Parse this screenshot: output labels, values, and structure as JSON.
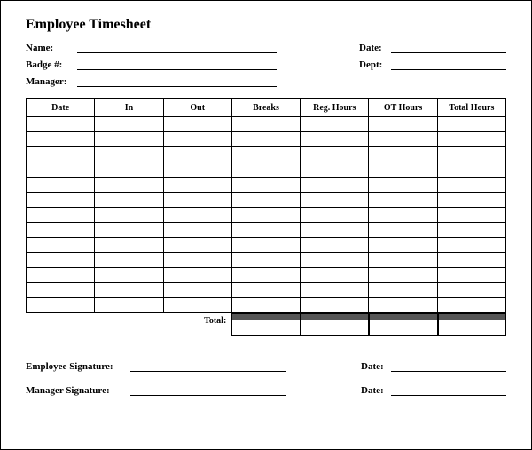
{
  "title": "Employee Timesheet",
  "fields": {
    "name_label": "Name:",
    "badge_label": "Badge #:",
    "manager_label": "Manager:",
    "date_label": "Date:",
    "dept_label": "Dept:"
  },
  "columns": [
    "Date",
    "In",
    "Out",
    "Breaks",
    "Reg. Hours",
    "OT Hours",
    "Total Hours"
  ],
  "row_count": 13,
  "totals_label": "Total:",
  "signatures": {
    "employee_label": "Employee Signature:",
    "manager_label": "Manager Signature:",
    "date_label": "Date:"
  }
}
